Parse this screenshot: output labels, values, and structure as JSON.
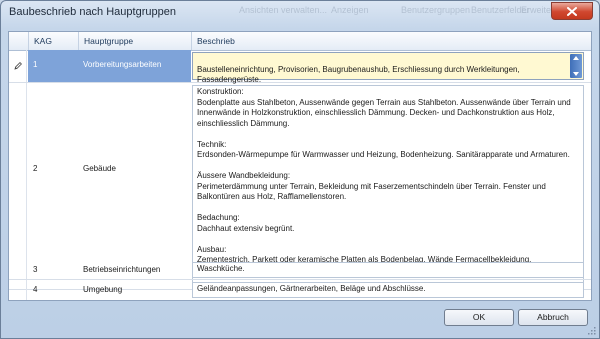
{
  "window": {
    "title": "Baubeschrieb nach Hauptgruppen",
    "background_ghost_texts": [
      "Ansichten verwalten...",
      "Anzeigen",
      "Benutzergruppen",
      "Benutzerfelder",
      "Erweitert"
    ]
  },
  "grid": {
    "columns": {
      "kag": "KAG",
      "hauptgruppe": "Hauptgruppe",
      "beschrieb": "Beschrieb"
    },
    "rows": [
      {
        "kag": "1",
        "hauptgruppe": "Vorbereitungsarbeiten",
        "beschrieb": "Baustelleneinrichtung, Provisorien, Baugrubenaushub, Erschliessung durch Werkleitungen,\nFassadengerüste.",
        "selected": true
      },
      {
        "kag": "2",
        "hauptgruppe": "Gebäude",
        "beschrieb": "Konstruktion:\nBodenplatte aus Stahlbeton, Aussenwände gegen Terrain aus Stahlbeton. Aussenwände über Terrain und\nInnenwände in Holzkonstruktion, einschliesslich Dämmung. Decken- und Dachkonstruktion aus Holz,\neinschliesslich Dämmung.\n\nTechnik:\nErdsonden-Wärmepumpe für Warmwasser und Heizung, Bodenheizung. Sanitärapparate und Armaturen.\n\nÄussere Wandbekleidung:\nPerimeterdämmung unter Terrain, Bekleidung mit Faserzementschindeln über Terrain. Fenster und\nBalkontüren aus Holz, Rafflamellenstoren.\n\nBedachung:\nDachhaut extensiv begrünt.\n\nAusbau:\nZementestrich, Parkett oder keramische Platten als Bodenbelag. Wände Fermacellbekleidung,\nFeinspachtelung. Einbauten. Einbauküche.",
        "selected": false
      },
      {
        "kag": "3",
        "hauptgruppe": "Betriebseinrichtungen",
        "beschrieb": "Waschküche.",
        "selected": false
      },
      {
        "kag": "4",
        "hauptgruppe": "Umgebung",
        "beschrieb": "Geländeanpassungen, Gärtnerarbeiten, Beläge und Abschlüsse.",
        "selected": false
      }
    ]
  },
  "buttons": {
    "ok": "OK",
    "cancel": "Abbruch"
  },
  "colors": {
    "selection": "#7ea3d9",
    "edit_background": "#fff9d2",
    "close_button": "#d0472f"
  }
}
